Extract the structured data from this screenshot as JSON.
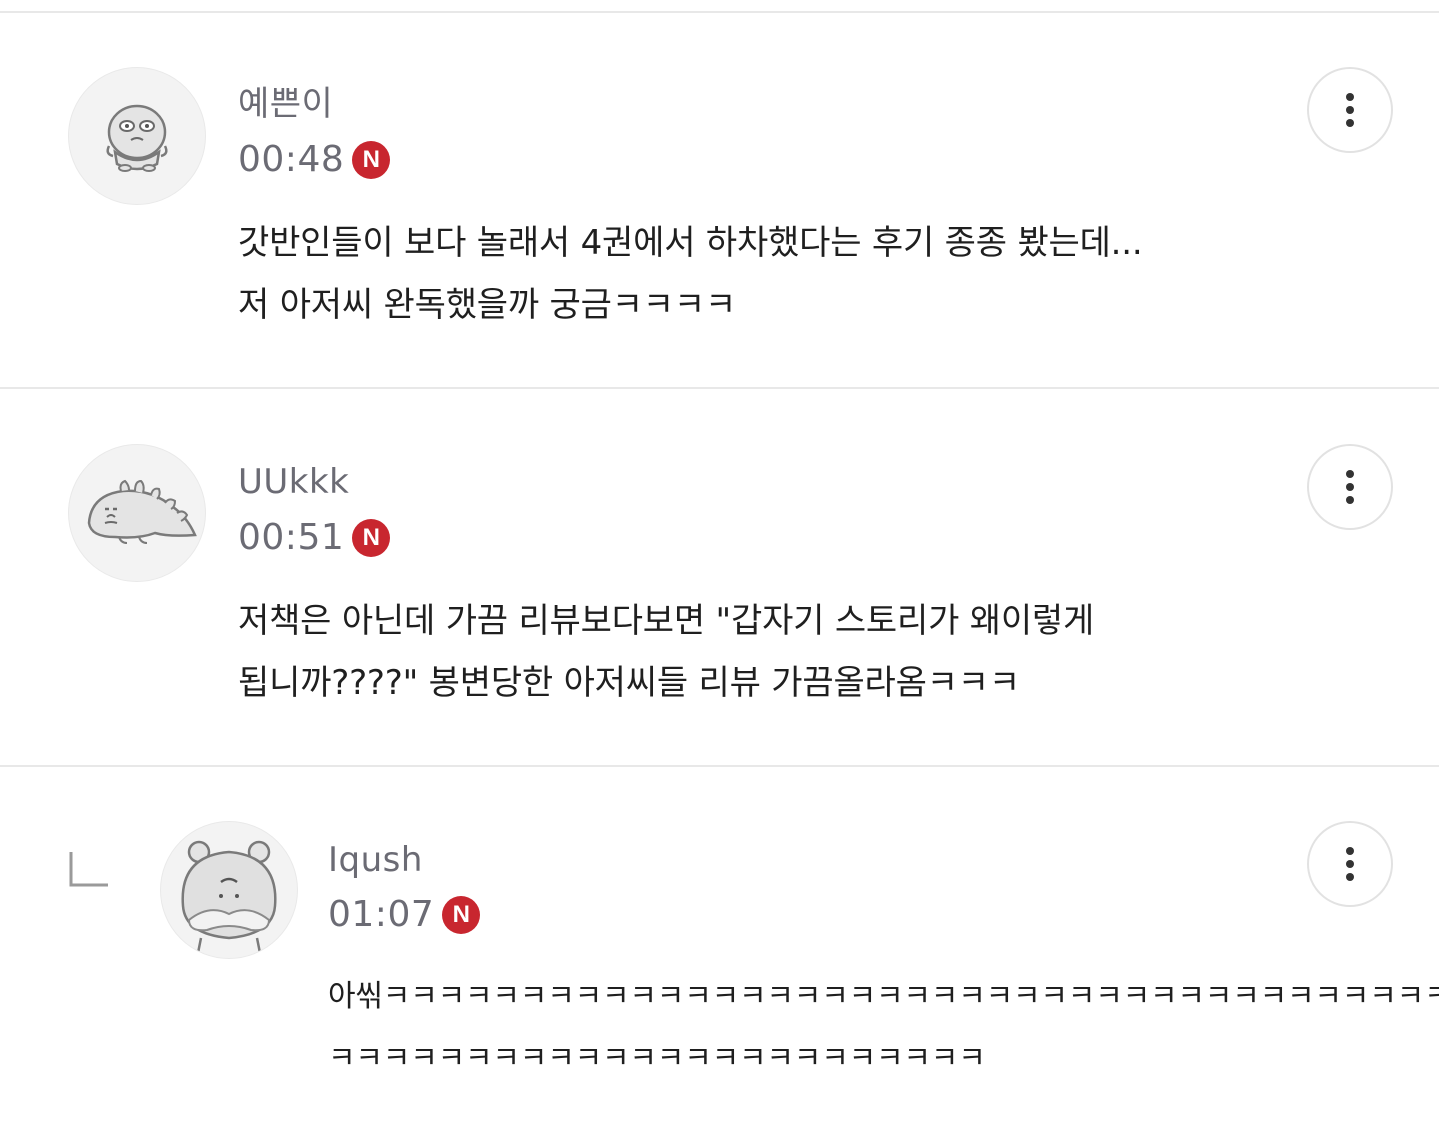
{
  "comments": [
    {
      "nickname": "예쁜이",
      "time": "00:48",
      "badge": "N",
      "lines": [
        "갓반인들이 보다 놀래서 4권에서 하차했다는 후기 종종 봤는데...",
        "저 아저씨 완독했을까 궁금ㅋㅋㅋㅋ"
      ],
      "avatar_icon": "cartoon-character-icon",
      "more_icon": "more-vertical-icon",
      "is_reply": false
    },
    {
      "nickname": "UUkkk",
      "time": "00:51",
      "badge": "N",
      "lines": [
        "저책은 아닌데 가끔 리뷰보다보면 \"갑자기 스토리가 왜이렇게",
        "됩니까????\" 봉변당한 아저씨들 리뷰 가끔올라옴ㅋㅋㅋ"
      ],
      "avatar_icon": "cartoon-dinosaur-icon",
      "more_icon": "more-vertical-icon",
      "is_reply": false
    },
    {
      "nickname": "Iqush",
      "time": "01:07",
      "badge": "N",
      "lines": [
        "아씪ㅋㅋㅋㅋㅋㅋㅋㅋㅋㅋㅋㅋㅋㅋㅋㅋㅋㅋㅋㅋㅋㅋㅋㅋㅋㅋㅋㅋㅋㅋㅋㅋㅋㅋㅋㅋㅋㅋㅋㅋ",
        "ㅋㅋㅋㅋㅋㅋㅋㅋㅋㅋㅋㅋㅋㅋㅋㅋㅋㅋㅋㅋㅋㅋㅋㅋ"
      ],
      "avatar_icon": "cartoon-hamster-icon",
      "more_icon": "more-vertical-icon",
      "reply_icon": "reply-arrow-icon",
      "is_reply": true
    }
  ],
  "colors": {
    "new_badge": "#c8262f",
    "meta_text": "#6b6b74",
    "divider": "#e8e8e8"
  }
}
